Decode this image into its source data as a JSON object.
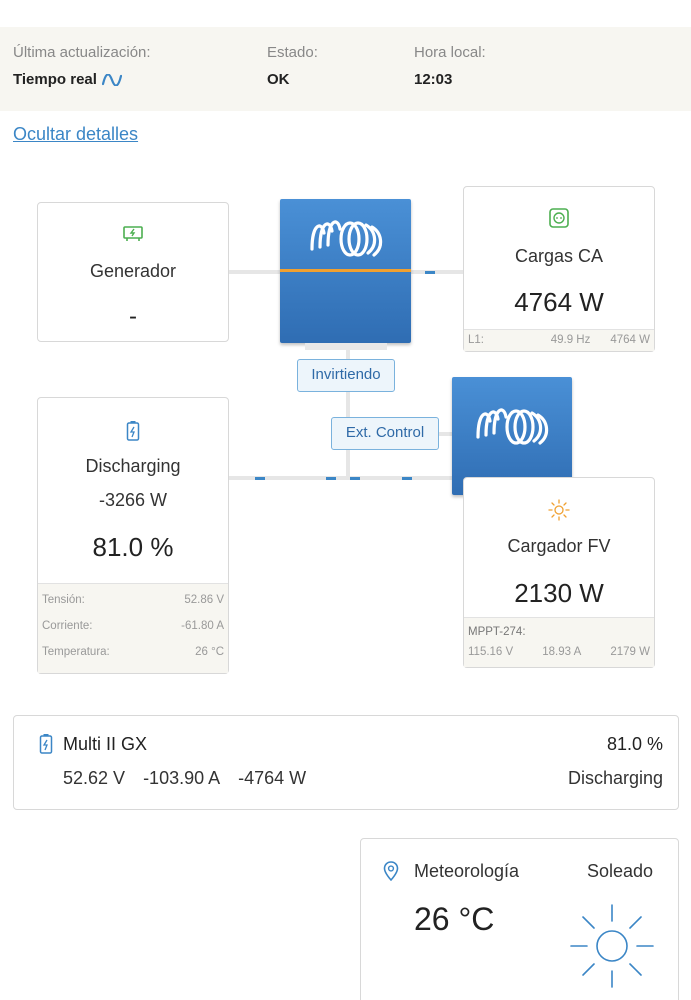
{
  "status": {
    "last_update_label": "Última actualización:",
    "last_update_value": "Tiempo real",
    "state_label": "Estado:",
    "state_value": "OK",
    "local_time_label": "Hora local:",
    "local_time_value": "12:03"
  },
  "hide_details": "Ocultar detalles",
  "generator": {
    "title": "Generador",
    "value": "-"
  },
  "ac_loads": {
    "title": "Cargas CA",
    "value": "4764 W",
    "footer": {
      "phase": "L1:",
      "freq": "49.9 Hz",
      "power": "4764 W"
    }
  },
  "inverter": {
    "state_tag": "Invirtiendo"
  },
  "ext_control": "Ext. Control",
  "battery": {
    "state": "Discharging",
    "power": "-3266 W",
    "soc": "81.0 %",
    "rows": [
      {
        "label": "Tensión:",
        "value": "52.86 V"
      },
      {
        "label": "Corriente:",
        "value": "-61.80 A"
      },
      {
        "label": "Temperatura:",
        "value": "26 °C"
      }
    ]
  },
  "pv_charger": {
    "title": "Cargador FV",
    "value": "2130 W",
    "mppt_label": "MPPT-274:",
    "voltage": "115.16 V",
    "current": "18.93 A",
    "power": "2179 W"
  },
  "device": {
    "name": "Multi II GX",
    "soc": "81.0 %",
    "voltage": "52.62 V",
    "current": "-103.90 A",
    "power": "-4764 W",
    "state": "Discharging"
  },
  "weather": {
    "title": "Meteorología",
    "condition": "Soleado",
    "temperature": "26 °C"
  },
  "colors": {
    "accent": "#3b86c6",
    "inverter_blue": "#3d7fc8",
    "ac_line": "#f0a030",
    "footer_bg": "#f7f6f1",
    "pv_icon": "#f0a030",
    "ac_icon": "#4caf50"
  }
}
